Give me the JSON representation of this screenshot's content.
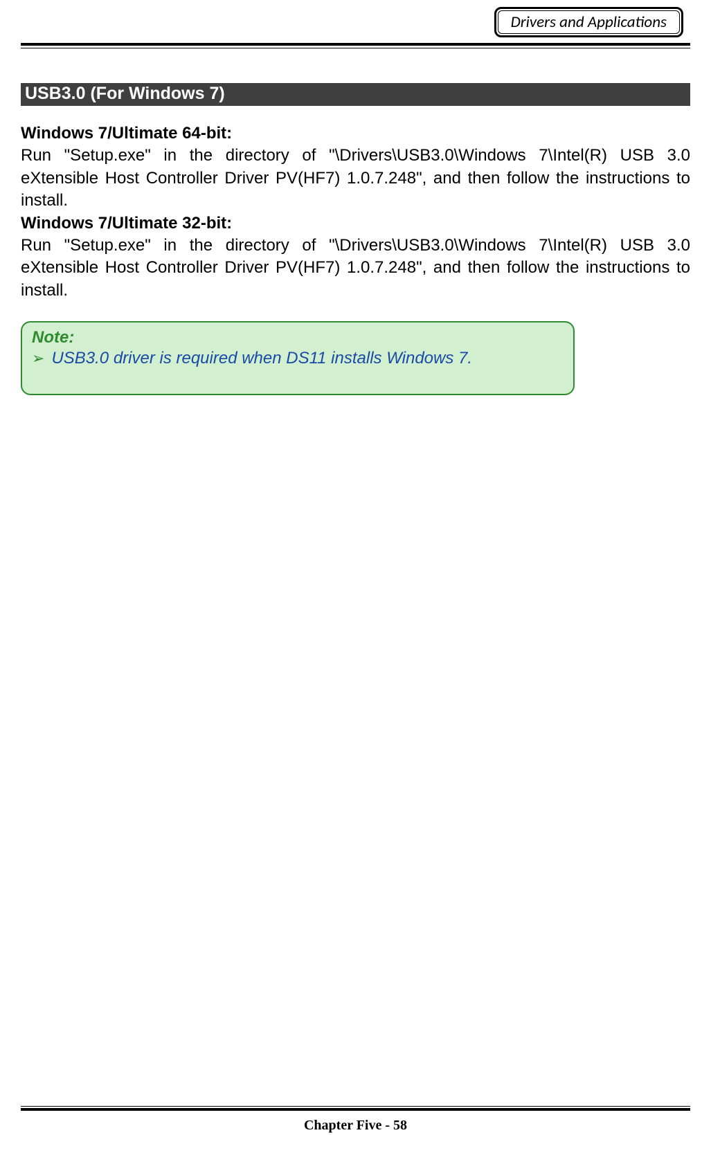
{
  "header": {
    "badge": "Drivers and Applications"
  },
  "section": {
    "heading": " USB3.0 (For Windows 7)                                                 "
  },
  "body": {
    "sub1_title": "Windows 7/Ultimate 64-bit:",
    "sub1_text": "Run \"Setup.exe\" in the directory of \"\\Drivers\\USB3.0\\Windows 7\\Intel(R) USB 3.0 eXtensible Host Controller Driver PV(HF7) 1.0.7.248\", and then follow the instructions to install.",
    "sub2_title": "Windows 7/Ultimate 32-bit:",
    "sub2_text": "Run \"Setup.exe\" in the directory of \"\\Drivers\\USB3.0\\Windows 7\\Intel(R) USB 3.0 eXtensible Host Controller Driver PV(HF7) 1.0.7.248\", and then follow the instructions to install."
  },
  "note": {
    "title": "Note:",
    "bullet_glyph": "➢",
    "item1": "USB3.0 driver is required when DS11 installs Windows 7."
  },
  "footer": {
    "text": "Chapter Five - 58"
  }
}
